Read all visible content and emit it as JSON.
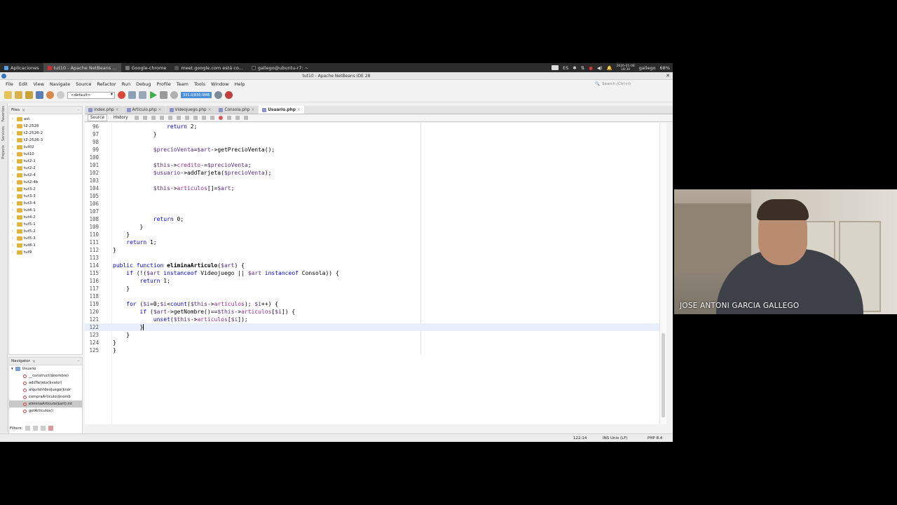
{
  "taskbar": {
    "items": [
      {
        "label": "Aplicaciones"
      },
      {
        "label": "tut10 - Apache NetBeans ..."
      },
      {
        "label": "Google-chrome"
      },
      {
        "label": "meet.google.com está co..."
      },
      {
        "label": "gallego@ubuntu-r7: ~"
      }
    ],
    "tray": {
      "lang": "ES",
      "date": "2026-01-08",
      "time": "18:30",
      "user": "gallego",
      "battery": "68%"
    }
  },
  "window": {
    "title": "tut10 - Apache NetBeans IDE 28"
  },
  "menu": [
    "File",
    "Edit",
    "View",
    "Navigate",
    "Source",
    "Refactor",
    "Run",
    "Debug",
    "Profile",
    "Team",
    "Tools",
    "Window",
    "Help"
  ],
  "search": {
    "placeholder": "Search (Ctrl+I)"
  },
  "toolbar": {
    "config": "<default>",
    "memory": "331.0/830.0MB"
  },
  "sidestrip": [
    "Favorites",
    "Services",
    "Projects"
  ],
  "files": {
    "title": "Files",
    "items": [
      "ast",
      "t2-2526",
      "t2-2526-2",
      "t2-2526-3",
      "tut02",
      "tut10",
      "tut2-1",
      "tut2-2",
      "tut2-4",
      "tut2-4b",
      "tut3-2",
      "tut3-3",
      "tut3-4",
      "tut4-1",
      "tut4-2",
      "tut5-1",
      "tut5-2",
      "tut5-3",
      "tut8-1",
      "tut9"
    ]
  },
  "navigator": {
    "title": "Navigator",
    "root": "Usuario",
    "items": [
      "__construct($nombre)",
      "addTarjeta($valor)",
      "alquilaVideojuego($nor",
      "compraArticulo($nomb",
      "eliminaArticulo($art):int",
      "getArticulos()"
    ],
    "selected_index": 4,
    "filters_label": "Filters:"
  },
  "editor": {
    "tabs": [
      {
        "label": "index.php"
      },
      {
        "label": "Articulo.php"
      },
      {
        "label": "Videojuego.php"
      },
      {
        "label": "Consola.php"
      },
      {
        "label": "Usuario.php"
      }
    ],
    "active_tab": 4,
    "source_label": "Source",
    "history_label": "History",
    "lines": [
      {
        "n": "96",
        "code": "                return 2;"
      },
      {
        "n": "97",
        "code": "            }"
      },
      {
        "n": "98",
        "code": ""
      },
      {
        "n": "99",
        "code": "            $precioVenta=$art->getPrecioVenta();"
      },
      {
        "n": "100",
        "code": ""
      },
      {
        "n": "101",
        "code": "            $this->credito-=$precioVenta;"
      },
      {
        "n": "102",
        "code": "            $usuario->addTarjeta($precioVenta);"
      },
      {
        "n": "103",
        "code": ""
      },
      {
        "n": "104",
        "code": "            $this->articulos[]=$art;"
      },
      {
        "n": "105",
        "code": ""
      },
      {
        "n": "106",
        "code": ""
      },
      {
        "n": "107",
        "code": ""
      },
      {
        "n": "108",
        "code": "            return 0;"
      },
      {
        "n": "109",
        "code": "        }"
      },
      {
        "n": "110",
        "code": "    }"
      },
      {
        "n": "111",
        "code": "    return 1;"
      },
      {
        "n": "112",
        "code": "}"
      },
      {
        "n": "113",
        "code": ""
      },
      {
        "n": "114",
        "code": "public function eliminaArticulo($art) {"
      },
      {
        "n": "115",
        "code": "    if (!($art instanceof Videojuego || $art instanceof Consola)) {"
      },
      {
        "n": "116",
        "code": "        return 1;"
      },
      {
        "n": "117",
        "code": "    }"
      },
      {
        "n": "118",
        "code": ""
      },
      {
        "n": "119",
        "code": "    for ($i=0;$i<count($this->articulos); $i++) {"
      },
      {
        "n": "120",
        "code": "        if ($art->getNombre()==$this->articulos[$i]) {"
      },
      {
        "n": "121",
        "code": "            unset($this->articulos[$i]);"
      },
      {
        "n": "122",
        "code": "        }"
      },
      {
        "n": "123",
        "code": "    }"
      },
      {
        "n": "124",
        "code": "}"
      },
      {
        "n": "125",
        "code": "}"
      }
    ]
  },
  "status": {
    "position": "122:14",
    "mode": "INS Unix (LF)",
    "php": "PHP 8.4"
  },
  "webcam": {
    "name": "JOSE ANTONI GARCIA GALLEGO"
  }
}
